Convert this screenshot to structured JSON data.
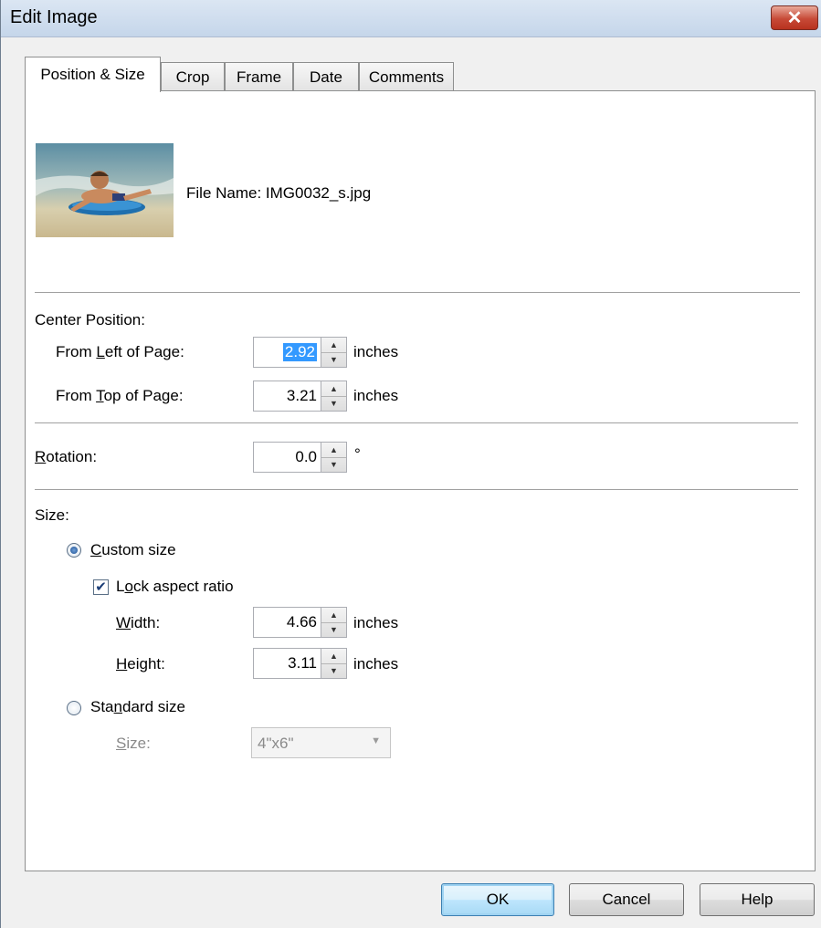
{
  "window": {
    "title": "Edit Image",
    "close_label": "✕"
  },
  "tabs": [
    "Position & Size",
    "Crop",
    "Frame",
    "Date",
    "Comments"
  ],
  "file": {
    "label": "File Name:",
    "name": "IMG0032_s.jpg"
  },
  "center_position": {
    "heading": "Center Position:",
    "left": {
      "label_pre": "From ",
      "label_key": "L",
      "label_post": "eft of Page:",
      "value": "2.92",
      "unit": "inches"
    },
    "top": {
      "label_pre": "From ",
      "label_key": "T",
      "label_post": "op of Page:",
      "value": "3.21",
      "unit": "inches"
    }
  },
  "rotation": {
    "label_key": "R",
    "label_post": "otation:",
    "value": "0.0",
    "unit": "°"
  },
  "size": {
    "heading": "Size:",
    "custom": {
      "label_key": "C",
      "label_post": "ustom size",
      "selected": true
    },
    "lock_aspect": {
      "label_pre": "L",
      "label_key": "o",
      "label_post": "ck aspect ratio",
      "checked": true
    },
    "width": {
      "label_key": "W",
      "label_post": "idth:",
      "value": "4.66",
      "unit": "inches"
    },
    "height": {
      "label_key": "H",
      "label_post": "eight:",
      "value": "3.11",
      "unit": "inches"
    },
    "standard": {
      "label_pre": "Sta",
      "label_key": "n",
      "label_post": "dard size",
      "selected": false
    },
    "standard_size": {
      "label_key": "S",
      "label_post": "ize:",
      "value": "4\"x6\""
    }
  },
  "buttons": {
    "ok": "OK",
    "cancel": "Cancel",
    "help": "Help"
  },
  "colors": {
    "accent_selection": "#3399ff",
    "close_button": "#c74a37"
  },
  "icons": {
    "close": "close-icon",
    "spin_up": "triangle-up-icon",
    "spin_down": "triangle-down-icon",
    "dropdown": "chevron-down-icon",
    "checkmark": "checkmark-icon"
  }
}
